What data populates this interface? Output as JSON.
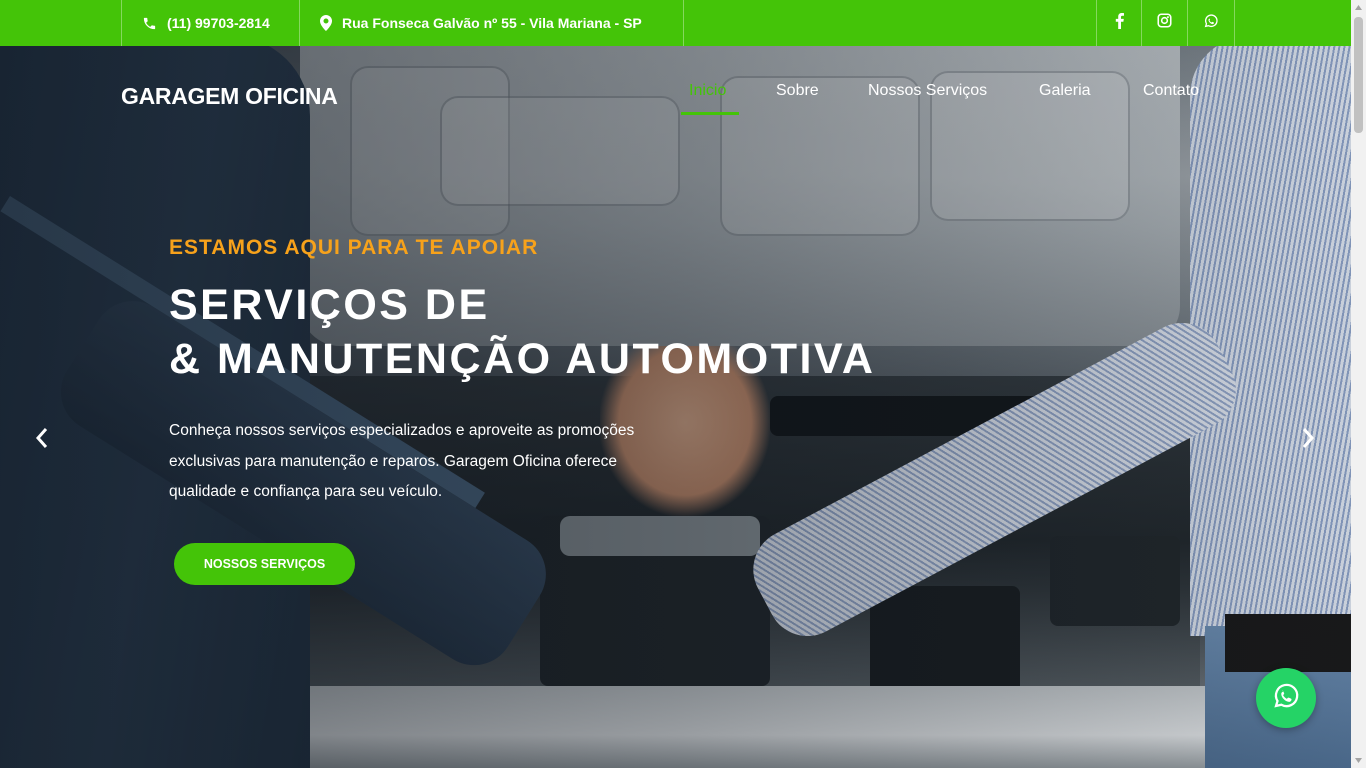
{
  "topbar": {
    "phone": "(11) 99703-2814",
    "address": "Rua Fonseca Galvão nº 55 - Vila Mariana - SP",
    "phone_icon": "phone-icon",
    "address_icon": "map-marker-icon",
    "social": [
      "facebook-icon",
      "instagram-icon",
      "whatsapp-icon"
    ],
    "bg_color": "#44c408"
  },
  "header": {
    "brand": "GARAGEM OFICINA",
    "nav": [
      {
        "label": "Inicio",
        "active": true
      },
      {
        "label": "Sobre"
      },
      {
        "label": "Nossos Serviços"
      },
      {
        "label": "Galeria"
      },
      {
        "label": "Contato"
      }
    ]
  },
  "hero": {
    "eyebrow": "ESTAMOS AQUI PARA TE APOIAR",
    "title_line1": "SERVIÇOS DE",
    "title_line2": "& MANUTENÇÃO AUTOMOTIVA",
    "lead_line1": "Conheça nossos serviços especializados e aproveite as promoções",
    "lead_line2": "exclusivas para manutenção e reparos. Garagem Oficina oferece",
    "lead_line3": "qualidade e confiança para seu veículo.",
    "cta": "NOSSOS SERVIÇOS",
    "eyebrow_color": "#f7a21b",
    "accent_color": "#44c408",
    "arrows": [
      "chevron-left-icon",
      "chevron-right-icon"
    ]
  },
  "floating": {
    "whatsapp_icon": "whatsapp-icon",
    "color": "#25d366"
  }
}
